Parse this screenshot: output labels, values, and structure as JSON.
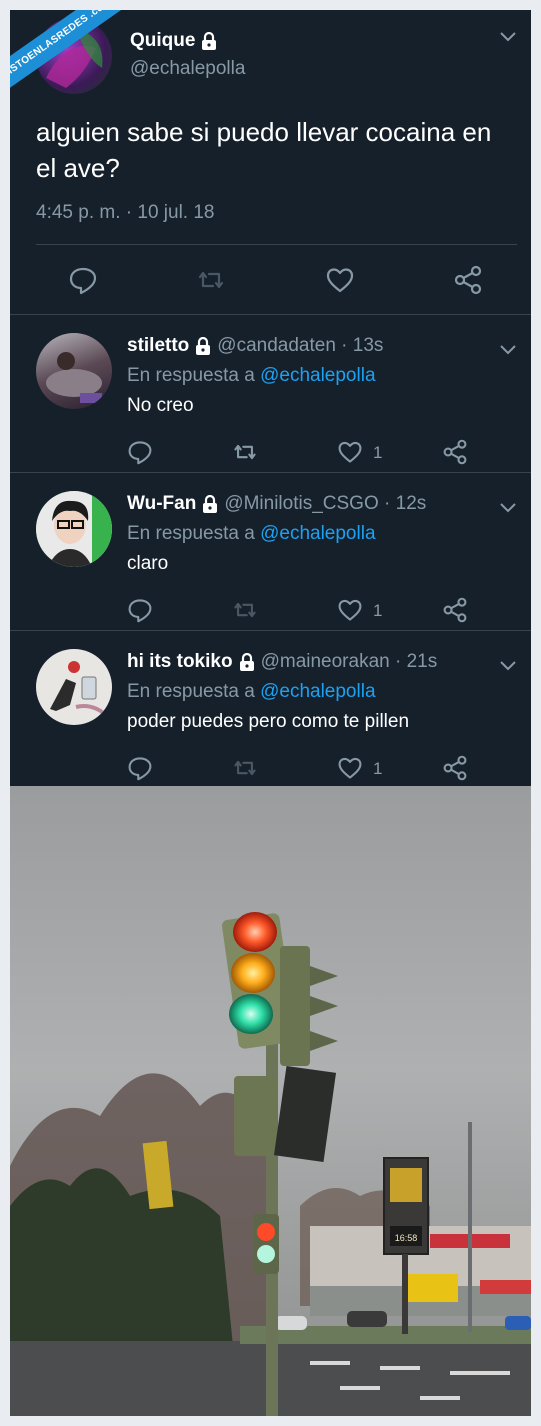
{
  "watermark": "VISTOENLASREDES .com",
  "main_tweet": {
    "name": "Quique",
    "handle": "@echalepolla",
    "text": "alguien sabe si puedo llevar cocaina en el ave?",
    "timestamp": "4:45 p. m. · 10 jul. 18"
  },
  "replies": [
    {
      "name": "stiletto",
      "handle": "@candadaten · 13s",
      "in_reply_prefix": "En respuesta a",
      "in_reply_to": "@echalepolla",
      "text": "No creo",
      "likes": "1"
    },
    {
      "name": "Wu-Fan",
      "handle": "@Minilotis_CSGO · 12s",
      "in_reply_prefix": "En respuesta a",
      "in_reply_to": "@echalepolla",
      "text": "claro",
      "likes": "1"
    },
    {
      "name": "hi its tokiko",
      "handle": "@maineorakan · 21s",
      "in_reply_prefix": "En respuesta a",
      "in_reply_to": "@echalepolla",
      "text": "poder puedes pero como te pillen",
      "likes": "1"
    }
  ],
  "photo": {
    "sign_time": "16:58"
  },
  "colors": {
    "background": "#15202b",
    "text": "#ffffff",
    "muted": "#8899a6",
    "link": "#1da1f2",
    "border": "#38444d",
    "watermark": "#1d8fd6"
  }
}
